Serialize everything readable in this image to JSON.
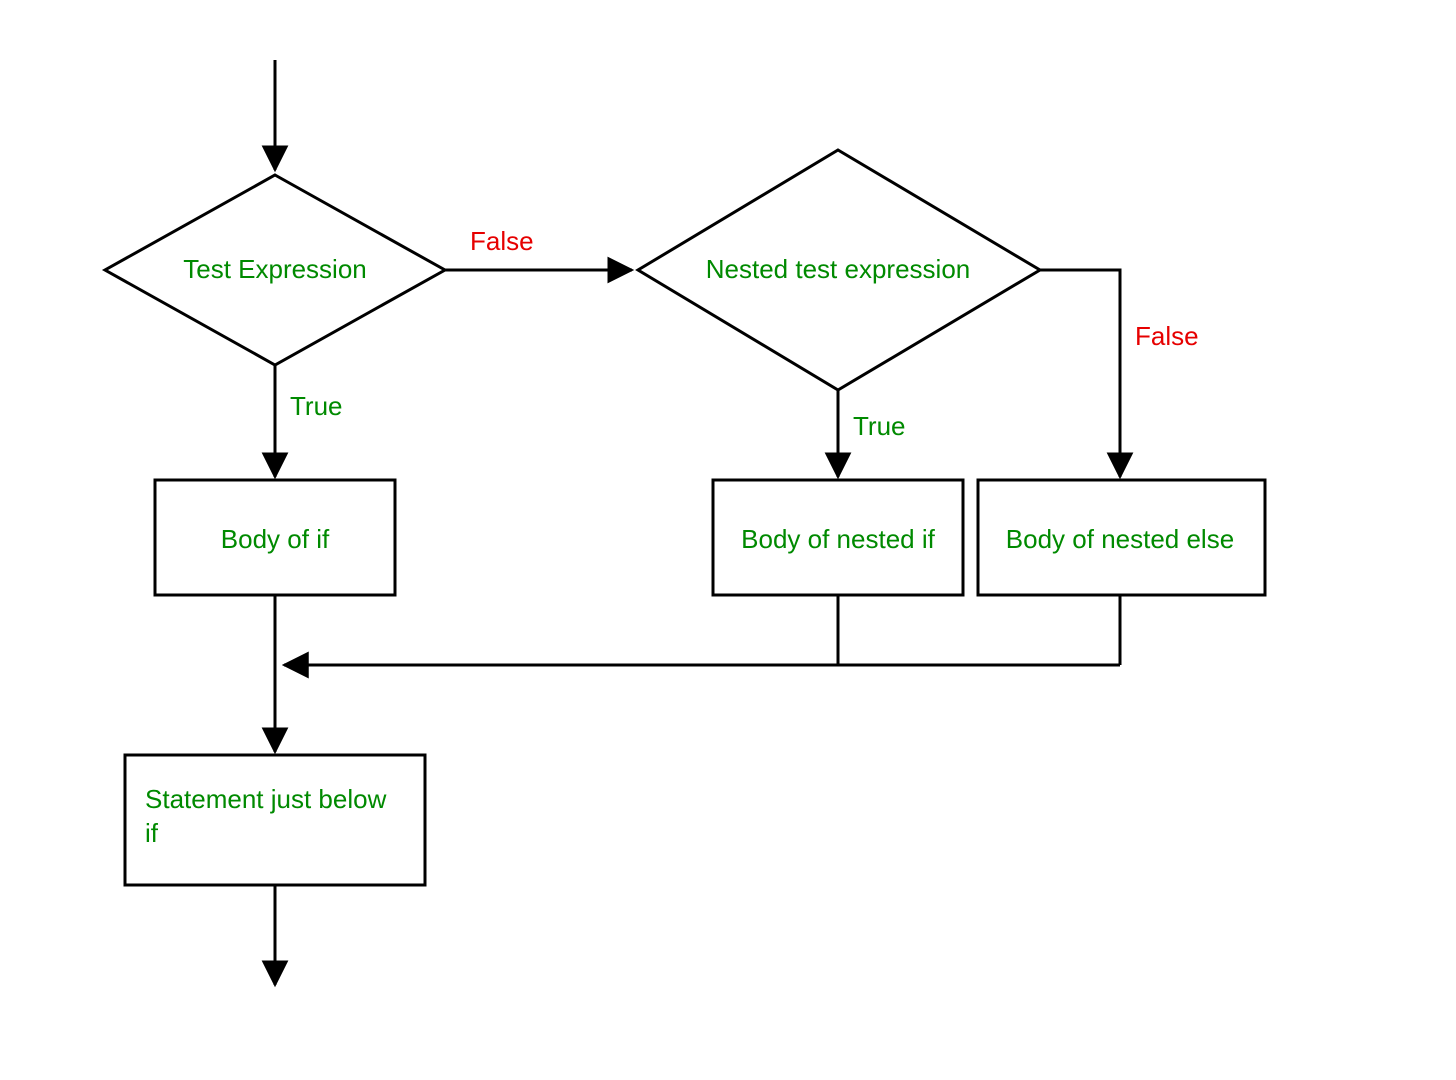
{
  "diagram": {
    "nodes": {
      "decision1": "Test Expression",
      "decision2": "Nested test expression",
      "body_if": "Body of if",
      "body_nested_if": "Body of nested if",
      "body_nested_else": "Body of nested else",
      "statement_below_line1": "Statement just below",
      "statement_below_line2": "if"
    },
    "edges": {
      "false1": "False",
      "true1": "True",
      "false2": "False",
      "true2": "True"
    },
    "colors": {
      "node_text": "#008a00",
      "true_text": "#008a00",
      "false_text": "#e60000",
      "stroke": "#000000"
    }
  }
}
